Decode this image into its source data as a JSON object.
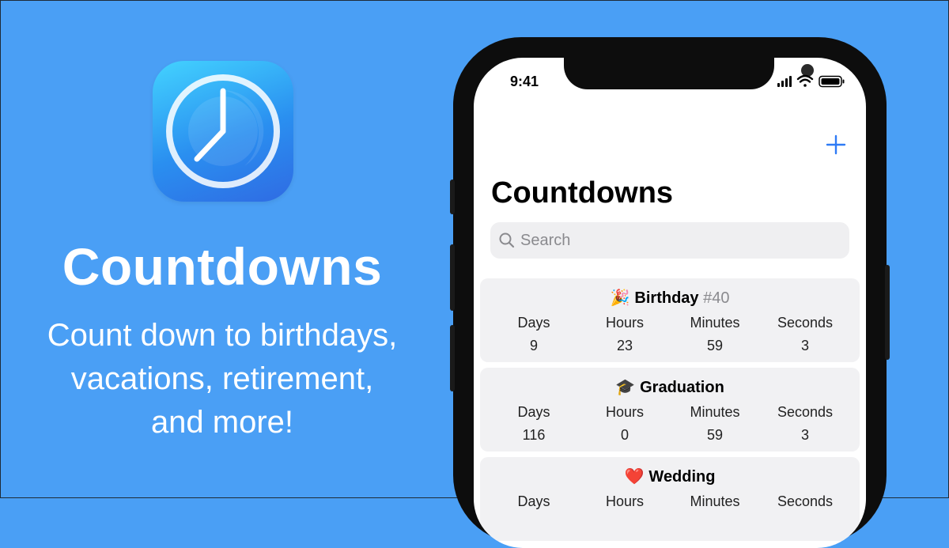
{
  "promo": {
    "title": "Countdowns",
    "subtitle_lines": [
      "Count down to birthdays,",
      "vacations, retirement,",
      "and more!"
    ]
  },
  "status_bar": {
    "time": "9:41"
  },
  "nav": {
    "title": "Countdowns",
    "add_icon": "plus-icon"
  },
  "search": {
    "placeholder": "Search"
  },
  "column_labels": [
    "Days",
    "Hours",
    "Minutes",
    "Seconds"
  ],
  "countdowns": [
    {
      "emoji": "🎉",
      "name": "Birthday",
      "number": "#40",
      "values": [
        "9",
        "23",
        "59",
        "3"
      ]
    },
    {
      "emoji": "🎓",
      "name": "Graduation",
      "number": "",
      "values": [
        "116",
        "0",
        "59",
        "3"
      ]
    },
    {
      "emoji": "❤️",
      "name": "Wedding",
      "number": "",
      "values": [
        "",
        "",
        "",
        ""
      ]
    }
  ],
  "colors": {
    "background": "#4a9ff5",
    "accent": "#2f7bf5",
    "card": "#f1f1f3"
  }
}
